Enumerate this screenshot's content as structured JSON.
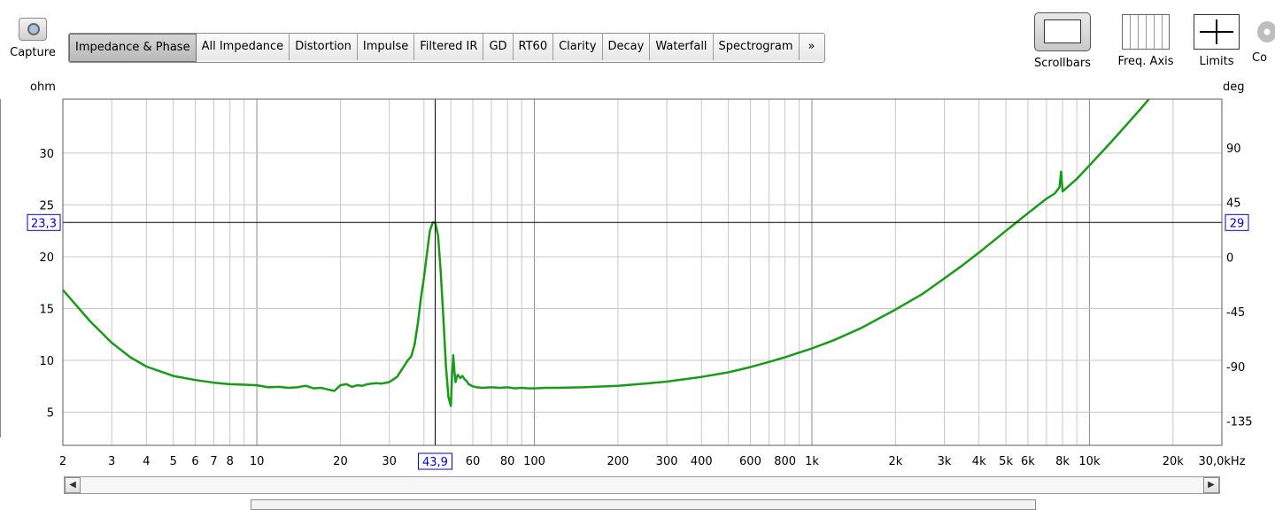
{
  "toolbar": {
    "capture_label": "Capture",
    "tabs": [
      {
        "label": "Impedance & Phase",
        "active": true
      },
      {
        "label": "All Impedance"
      },
      {
        "label": "Distortion"
      },
      {
        "label": "Impulse"
      },
      {
        "label": "Filtered IR"
      },
      {
        "label": "GD"
      },
      {
        "label": "RT60"
      },
      {
        "label": "Clarity"
      },
      {
        "label": "Decay"
      },
      {
        "label": "Waterfall"
      },
      {
        "label": "Spectrogram"
      },
      {
        "label": "»"
      }
    ],
    "scrollbars_label": "Scrollbars",
    "freq_axis_label": "Freq. Axis",
    "limits_label": "Limits",
    "co_label": "Co"
  },
  "icons": {
    "capture": "camera-icon",
    "scrollbars": "scrollbars-icon",
    "freq_axis": "freq-axis-icon",
    "limits": "limits-arrows-icon",
    "settings": "gear-icon",
    "scroll_left": "left-arrow-icon",
    "scroll_right": "right-arrow-icon"
  },
  "colors": {
    "curve": "#1a9a1a",
    "cursor_readout": "#0000cc",
    "grid": "#c8c8c8",
    "plot_bg": "#ffffff"
  },
  "chart_data": {
    "type": "line",
    "x_scale": "log",
    "xlim": [
      2,
      30000
    ],
    "ylim": [
      1.8,
      35.2
    ],
    "ylabel": "ohm",
    "y2label": "deg",
    "y2lim": [
      -155,
      130
    ],
    "x_ticks": [
      {
        "value": 2,
        "label": "2"
      },
      {
        "value": 3,
        "label": "3"
      },
      {
        "value": 4,
        "label": "4"
      },
      {
        "value": 5,
        "label": "5"
      },
      {
        "value": 6,
        "label": "6"
      },
      {
        "value": 7,
        "label": "7"
      },
      {
        "value": 8,
        "label": "8"
      },
      {
        "value": 10,
        "label": "10"
      },
      {
        "value": 20,
        "label": "20"
      },
      {
        "value": 30,
        "label": "30"
      },
      {
        "value": 60,
        "label": "60"
      },
      {
        "value": 80,
        "label": "80"
      },
      {
        "value": 100,
        "label": "100"
      },
      {
        "value": 200,
        "label": "200"
      },
      {
        "value": 300,
        "label": "300"
      },
      {
        "value": 400,
        "label": "400"
      },
      {
        "value": 600,
        "label": "600"
      },
      {
        "value": 800,
        "label": "800"
      },
      {
        "value": 1000,
        "label": "1k"
      },
      {
        "value": 2000,
        "label": "2k"
      },
      {
        "value": 3000,
        "label": "3k"
      },
      {
        "value": 4000,
        "label": "4k"
      },
      {
        "value": 5000,
        "label": "5k"
      },
      {
        "value": 6000,
        "label": "6k"
      },
      {
        "value": 8000,
        "label": "8k"
      },
      {
        "value": 10000,
        "label": "10k"
      },
      {
        "value": 20000,
        "label": "20k"
      },
      {
        "value": 30000,
        "label": "30,0kHz"
      }
    ],
    "y_ticks": [
      5,
      10,
      15,
      20,
      25,
      30
    ],
    "y2_ticks": [
      -135,
      -90,
      -45,
      0,
      45,
      90
    ],
    "grid": true,
    "cursor": {
      "x": 43.9,
      "y": 23.3,
      "x_label": "43,9",
      "y_label": "23,3",
      "y2_label": "29"
    },
    "series": [
      {
        "x": [
          2,
          2.5,
          3,
          3.5,
          4,
          5,
          6,
          7,
          8,
          9,
          10,
          11,
          12,
          13,
          14,
          15,
          16,
          17,
          18,
          19,
          20,
          21,
          22,
          23,
          24,
          25,
          26,
          27,
          28,
          30,
          32,
          34,
          35,
          36,
          37,
          38,
          39,
          40,
          41,
          42,
          43,
          43.9,
          45,
          46,
          47,
          48,
          49,
          50,
          50.5,
          51,
          51.5,
          52,
          52.5,
          53,
          54,
          55,
          56,
          57,
          58,
          60,
          62,
          65,
          70,
          75,
          80,
          85,
          90,
          95,
          100,
          110,
          120,
          150,
          200,
          250,
          300,
          400,
          500,
          600,
          700,
          800,
          900,
          1000,
          1200,
          1500,
          2000,
          2500,
          3000,
          3500,
          4000,
          5000,
          6000,
          7000,
          7500,
          7800,
          7900,
          8000,
          9000,
          10000,
          12000,
          15000,
          18000,
          20000,
          21000
        ],
        "values": [
          16.8,
          13.8,
          11.7,
          10.3,
          9.4,
          8.5,
          8.1,
          7.85,
          7.7,
          7.65,
          7.6,
          7.4,
          7.45,
          7.35,
          7.4,
          7.55,
          7.3,
          7.35,
          7.2,
          7.05,
          7.6,
          7.7,
          7.45,
          7.6,
          7.55,
          7.7,
          7.75,
          7.8,
          7.75,
          7.9,
          8.4,
          9.5,
          10.0,
          10.4,
          11.5,
          13.5,
          16.0,
          18.0,
          20.3,
          22.5,
          23.3,
          23.3,
          22.0,
          18.5,
          14.0,
          9.5,
          6.5,
          5.6,
          8.5,
          10.5,
          9.0,
          7.9,
          8.4,
          8.6,
          8.3,
          8.5,
          8.2,
          8.0,
          7.7,
          7.5,
          7.4,
          7.35,
          7.4,
          7.35,
          7.4,
          7.3,
          7.35,
          7.3,
          7.3,
          7.35,
          7.35,
          7.4,
          7.55,
          7.75,
          7.95,
          8.4,
          8.85,
          9.35,
          9.85,
          10.3,
          10.75,
          11.15,
          11.95,
          13.1,
          14.9,
          16.4,
          17.9,
          19.2,
          20.4,
          22.5,
          24.2,
          25.6,
          26.1,
          26.7,
          28.2,
          26.3,
          27.5,
          28.8,
          31.1,
          34.0,
          36.5,
          38.0,
          38.5
        ]
      }
    ]
  }
}
